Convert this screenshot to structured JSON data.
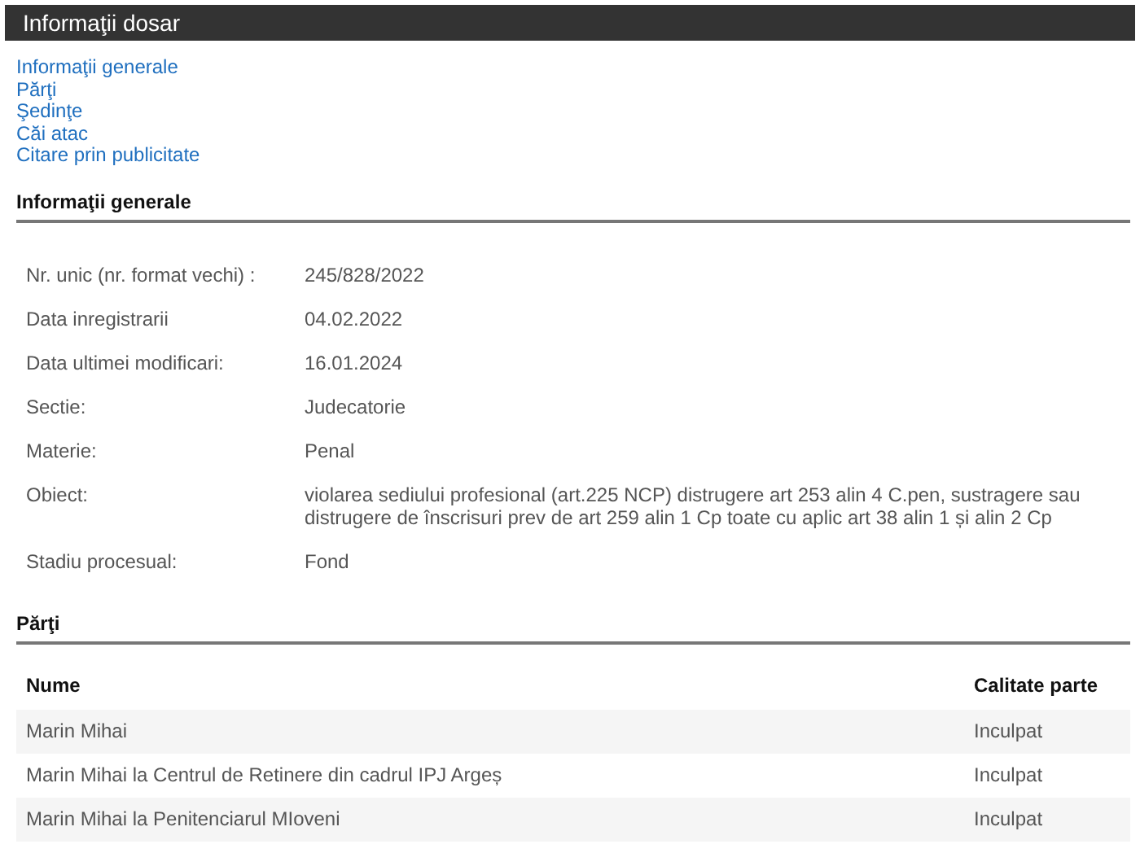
{
  "window": {
    "title": "Informaţii dosar"
  },
  "nav_links": [
    "Informaţii generale",
    "Părţi",
    "Şedinţe",
    "Căi atac",
    "Citare prin publicitate"
  ],
  "general_info": {
    "heading": "Informaţii generale",
    "fields": [
      {
        "label": "Nr. unic (nr. format vechi) :",
        "value": "245/828/2022"
      },
      {
        "label": "Data inregistrarii",
        "value": "04.02.2022"
      },
      {
        "label": "Data ultimei modificari:",
        "value": "16.01.2024"
      },
      {
        "label": "Sectie:",
        "value": "Judecatorie"
      },
      {
        "label": "Materie:",
        "value": "Penal"
      },
      {
        "label": "Obiect:",
        "value": "violarea sediului profesional (art.225 NCP) distrugere art 253 alin 4 C.pen, sustragere sau distrugere de înscrisuri prev de art 259 alin 1 Cp toate cu aplic art 38 alin 1 și alin 2 Cp"
      },
      {
        "label": "Stadiu procesual:",
        "value": "Fond"
      }
    ]
  },
  "parties": {
    "heading": "Părţi",
    "columns": [
      "Nume",
      "Calitate parte"
    ],
    "rows": [
      [
        "Marin Mihai",
        "Inculpat"
      ],
      [
        "Marin Mihai la Centrul de Retinere din cadrul IPJ Argeș",
        "Inculpat"
      ],
      [
        "Marin Mihai la Penitenciarul MIoveni",
        "Inculpat"
      ]
    ]
  }
}
